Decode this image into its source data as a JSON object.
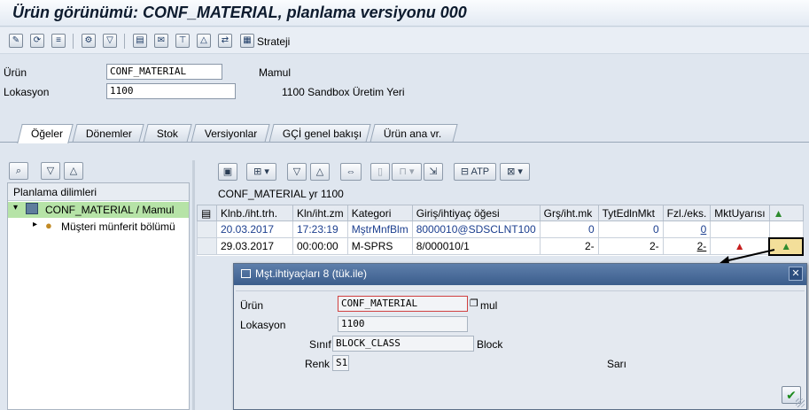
{
  "window": {
    "title": "Ürün görünümü: CONF_MATERIAL, planlama versiyonu 000"
  },
  "toolbar": {
    "icons": [
      "pencil-icon",
      "refresh-icon",
      "hierarchy-icon",
      "settings-icon",
      "filter-icon",
      "print-icon",
      "notes-icon",
      "transport-icon",
      "alert-icon",
      "pegging-icon",
      "strategy-icon"
    ],
    "strategy_label": "Strateji"
  },
  "header": {
    "product_label": "Ürün",
    "product_value": "CONF_MATERIAL",
    "product_desc": "Mamul",
    "location_label": "Lokasyon",
    "location_value": "1100",
    "location_desc": "1100 Sandbox Üretim Yeri"
  },
  "tabs": [
    {
      "label": "Öğeler",
      "active": true
    },
    {
      "label": "Dönemler",
      "active": false
    },
    {
      "label": "Stok",
      "active": false
    },
    {
      "label": "Versiyonlar",
      "active": false
    },
    {
      "label": "GÇİ genel bakışı",
      "active": false
    },
    {
      "label": "Ürün ana vr.",
      "active": false
    }
  ],
  "tree": {
    "header": "Planlama dilimleri",
    "root": "CONF_MATERIAL / Mamul",
    "child": "Müşteri münferit bölümü"
  },
  "grid": {
    "caption": "CONF_MATERIAL yr 1100",
    "atp_label": "ATP",
    "columns": [
      "Klnb./iht.trh.",
      "Kln/iht.zm",
      "Kategori",
      "Giriş/ihtiyaç öğesi",
      "Grş/iht.mk",
      "TytEdlnMkt",
      "Fzl./eks.",
      "MktUyarısı"
    ],
    "rows": [
      {
        "date": "20.03.2017",
        "time": "17:23:19",
        "category": "MştrMnfBlm",
        "element": "8000010@SDSCLNT100",
        "qty": "0",
        "confirmed": "0",
        "surplus": "0"
      },
      {
        "date": "29.03.2017",
        "time": "00:00:00",
        "category": "M-SPRS",
        "element": "8/000010/1",
        "qty": "2-",
        "confirmed": "2-",
        "surplus": "2-"
      }
    ]
  },
  "dialog": {
    "title": "Mşt.ihtiyaçları 8 (tük.ile)",
    "product_label": "Ürün",
    "product_value": "CONF_MATERIAL",
    "product_desc_suffix": "mul",
    "location_label": "Lokasyon",
    "location_value": "1100",
    "class_label": "Sınıf",
    "class_value": "BLOCK_CLASS",
    "class_desc": "Block",
    "color_label": "Renk",
    "color_value": "S1",
    "color_desc": "Sarı"
  },
  "colors": {
    "title_bar_text": "#0d1b2e",
    "dialog_title_bg": "#3b5d8c",
    "tree_highlight": "#b6e3a7",
    "link_blue": "#1c3f8f"
  }
}
